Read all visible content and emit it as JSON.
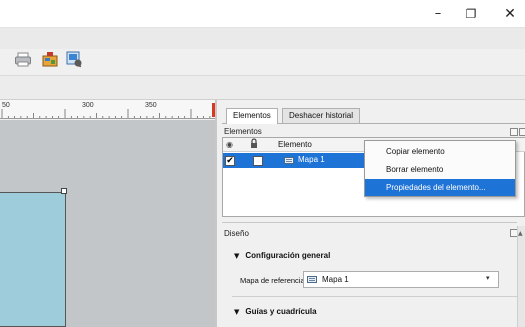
{
  "window": {
    "minimize_glyph": "–",
    "maximize_glyph": "❐",
    "close_glyph": "✕"
  },
  "toolbar": {
    "icons": [
      "print-icon",
      "export-image-icon",
      "export-pdf-icon"
    ]
  },
  "ruler": {
    "labels": [
      "50",
      "300",
      "350"
    ]
  },
  "panel": {
    "tabs": [
      "Elementos",
      "Deshacer historial"
    ],
    "items_title": "Elementos",
    "columns": {
      "visible_glyph": "◉",
      "element_label": "Elemento"
    },
    "rows": [
      {
        "visible": true,
        "locked": false,
        "label": "Mapa 1"
      }
    ],
    "check_glyph": "✔"
  },
  "context_menu": {
    "items": [
      "Copiar elemento",
      "Borrar elemento",
      "Propiedades del elemento..."
    ],
    "selected_index": 2
  },
  "design": {
    "title": "Diseño",
    "group_general": "Configuración general",
    "reference_map_label": "Mapa de referencia",
    "reference_map_value": "Mapa 1",
    "group_guides": "Guías y cuadrícula",
    "expand_glyph": "▼",
    "dropdown_glyph": "▾"
  },
  "colors": {
    "selection": "#1e73d6",
    "map_fill": "#9fccda",
    "canvas": "#c2c6c9"
  }
}
